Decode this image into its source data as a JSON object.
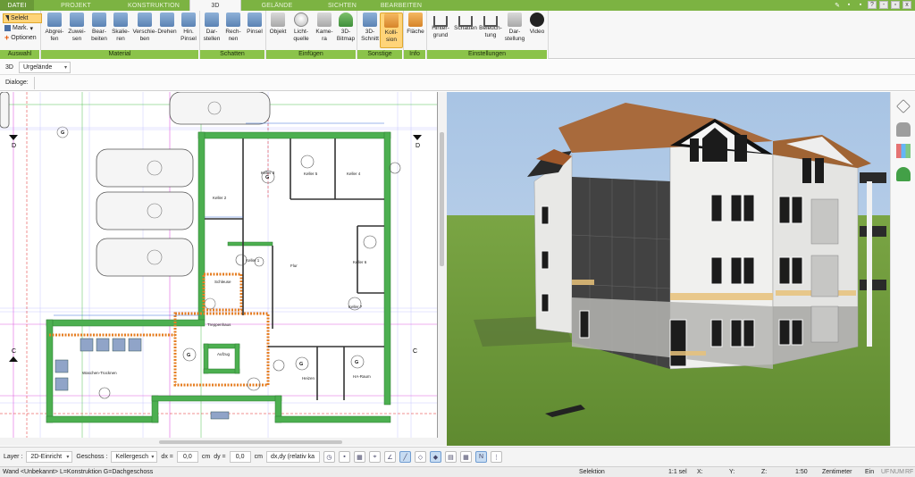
{
  "tabs": [
    "DATEI",
    "PROJEKT",
    "KONSTRUKTION",
    "3D",
    "GELÄNDE",
    "SICHTEN",
    "BEARBEITEN"
  ],
  "active_tab": "3D",
  "window_controls": {
    "min": "-",
    "max": "▫",
    "close": "x",
    "help": "?"
  },
  "selection": {
    "selekt": "Selekt",
    "mark": "Mark.",
    "optionen": "Optionen",
    "group": "Auswahl"
  },
  "groups": {
    "material": "Material",
    "schatten": "Schatten",
    "einfuegen": "Einfügen",
    "sonstige": "Sonstige",
    "info": "Info",
    "einstellungen": "Einstellungen"
  },
  "buttons": {
    "abgreifen": "Abgrei-\nfen",
    "zuweisen": "Zuwei-\nsen",
    "bearbeiten": "Bear-\nbeiten",
    "skalieren": "Skalie-\nren",
    "verschieben": "Verschie-\nben",
    "drehen": "Drehen",
    "hin_pinsel": "Hin.\nPinsel",
    "darstellen": "Dar-\nstellen",
    "rechnen": "Rech-\nnen",
    "pinsel": "Pinsel",
    "objekt": "Objekt",
    "lichtquelle": "Licht-\nquelle",
    "kamera": "Kame-\nra",
    "bitmap": "3D-\nBitmap",
    "schnitt": "3D-\nSchnitt",
    "kollision": "Kolli-\nsion",
    "flaeche": "Fläche",
    "hintergrund": "Hinter-\ngrund",
    "schatten": "Schatten",
    "beleuchtung": "Beleuch-\ntung",
    "darstellung": "Dar-\nstellung",
    "video": "Video"
  },
  "toolbar": {
    "view_mode": "3D",
    "terrain": "Urgelände",
    "dialoge": "Dialoge:"
  },
  "plan_labels": {
    "keller1": "Keller 1",
    "keller2": "Keller 2",
    "keller3": "Keller 3",
    "keller4": "Keller 4",
    "keller5": "Keller 5",
    "keller6": "Keller 6",
    "keller7": "Keller 7",
    "flur": "Flur",
    "treppenhaus": "Treppenhaus",
    "aufzug": "Aufzug",
    "schleuse": "Schleuse",
    "heizen": "Heizen",
    "ha_raum": "HA-Raum",
    "waschen": "Waschen-Trocknen",
    "axis_c": "C",
    "axis_d": "D",
    "axis_g": "G"
  },
  "bottom": {
    "layer_label": "Layer :",
    "layer_value": "2D-Einricht",
    "geschoss_label": "Geschoss :",
    "geschoss_value": "Kellergesch",
    "dx_label": "dx =",
    "dx_value": "0,0",
    "dy_label": "dy =",
    "dy_value": "0,0",
    "unit": "cm",
    "mode_value": "dx,dy (relativ ka"
  },
  "status": {
    "hint": "Wand <Unbekannt> L=Konstruktion G=Dachgeschoss",
    "mode": "Selektion",
    "scale": "1:1 sel",
    "x": "X:",
    "y": "Y:",
    "z": "Z:",
    "zoom": "1:50",
    "unit": "Zentimeter",
    "ein": "Ein",
    "uf": "UF",
    "num": "NUM",
    "rf": "RF"
  },
  "colors": {
    "ribbon_green": "#7cb342",
    "group_green": "#8bc34a",
    "active_yellow": "#ffd479",
    "sky": "#b5cde8",
    "lawn": "#6f9a3a"
  }
}
